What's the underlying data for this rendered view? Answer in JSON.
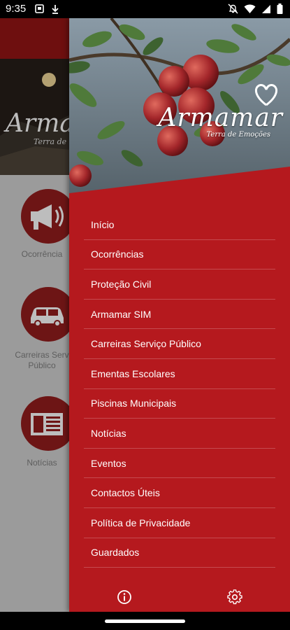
{
  "status_bar": {
    "time": "9:35",
    "left_icons": [
      "notification-square-icon",
      "download-icon"
    ],
    "right_icons": [
      "mute-icon",
      "wifi-icon",
      "cellular-signal-icon",
      "battery-icon"
    ]
  },
  "background_app": {
    "header_logo": "Armamar",
    "header_sub": "Terra de",
    "tiles": [
      {
        "icon": "megaphone-icon",
        "label": "Ocorrência"
      },
      {
        "icon": "car-icon",
        "label": "Carreiras Serv\nPúblico"
      },
      {
        "icon": "newspaper-icon",
        "label": "Notícias"
      }
    ]
  },
  "drawer": {
    "brand_name": "Armamar",
    "brand_tagline": "Terra de Emoções",
    "menu": [
      {
        "label": "Início"
      },
      {
        "label": "Ocorrências"
      },
      {
        "label": "Proteção Civil"
      },
      {
        "label": "Armamar SIM"
      },
      {
        "label": "Carreiras Serviço Público"
      },
      {
        "label": "Ementas Escolares"
      },
      {
        "label": "Piscinas Municipais"
      },
      {
        "label": "Notícias"
      },
      {
        "label": "Eventos"
      },
      {
        "label": "Contactos Úteis"
      },
      {
        "label": "Política de Privacidade"
      },
      {
        "label": "Guardados"
      }
    ],
    "footer_icons": [
      "info-icon",
      "settings-gear-icon"
    ]
  },
  "colors": {
    "drawer_red": "#b5191e",
    "dim_red": "#6d1515",
    "scrim_gray": "#9b9b9b"
  }
}
